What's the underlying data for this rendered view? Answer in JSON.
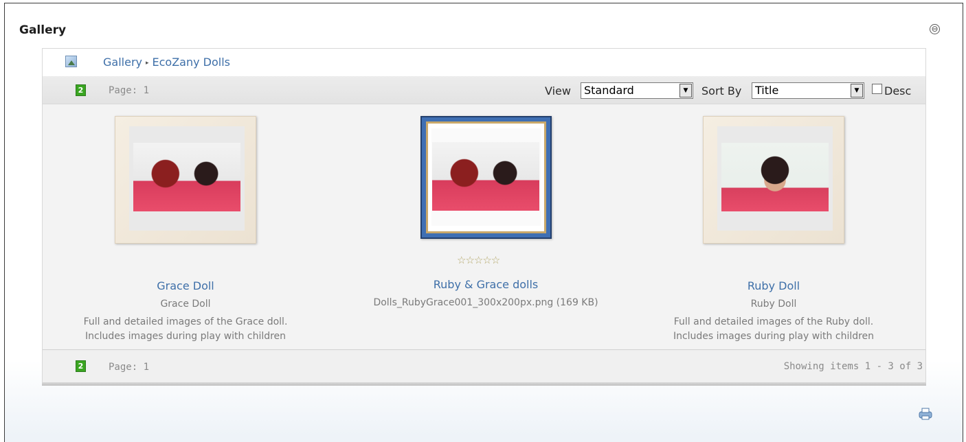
{
  "module": {
    "title": "Gallery",
    "collapse_glyph": "⊖"
  },
  "breadcrumb": {
    "root": "Gallery",
    "separator": "▸",
    "current": "EcoZany Dolls",
    "icon": "gallery-icon"
  },
  "toolbar": {
    "page_label": "Page: 1",
    "view_label": "View",
    "view_value": "Standard",
    "sort_label": "Sort By",
    "sort_value": "Title",
    "desc_label": "Desc",
    "desc_checked": false
  },
  "items": [
    {
      "title": "Grace Doll",
      "caption": "Grace Doll",
      "description_1": "Full and detailed images of the Grace doll.",
      "description_2": "Includes images during play with children"
    },
    {
      "title": "Ruby & Grace dolls",
      "file": "Dolls_RubyGrace001_300x200px.png (169 KB)",
      "stars": "☆☆☆☆☆",
      "selected": true
    },
    {
      "title": "Ruby Doll",
      "caption": "Ruby Doll",
      "description_1": "Full and detailed images of the Ruby doll.",
      "description_2": "Includes images during play with children"
    }
  ],
  "footer": {
    "page_label": "Page: 1",
    "showing": "Showing items 1 - 3 of 3"
  },
  "colors": {
    "link": "#3e6fa8",
    "frame_selected": "#3f6fb3",
    "refresh": "#3aa521"
  }
}
